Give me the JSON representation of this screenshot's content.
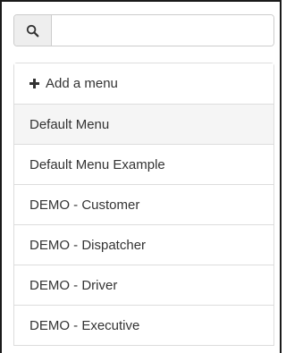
{
  "search": {
    "icon": "search-icon",
    "value": "",
    "placeholder": ""
  },
  "add_menu": {
    "icon": "plus-icon",
    "label": "Add a menu"
  },
  "menus": [
    {
      "label": "Default Menu",
      "selected": true
    },
    {
      "label": "Default Menu Example",
      "selected": false
    },
    {
      "label": "DEMO - Customer",
      "selected": false
    },
    {
      "label": "DEMO - Dispatcher",
      "selected": false
    },
    {
      "label": "DEMO - Driver",
      "selected": false
    },
    {
      "label": "DEMO - Executive",
      "selected": false
    }
  ],
  "colors": {
    "selected_background": "#f5f5f5",
    "border": "#dddddd",
    "addon_background": "#eeeeee"
  }
}
